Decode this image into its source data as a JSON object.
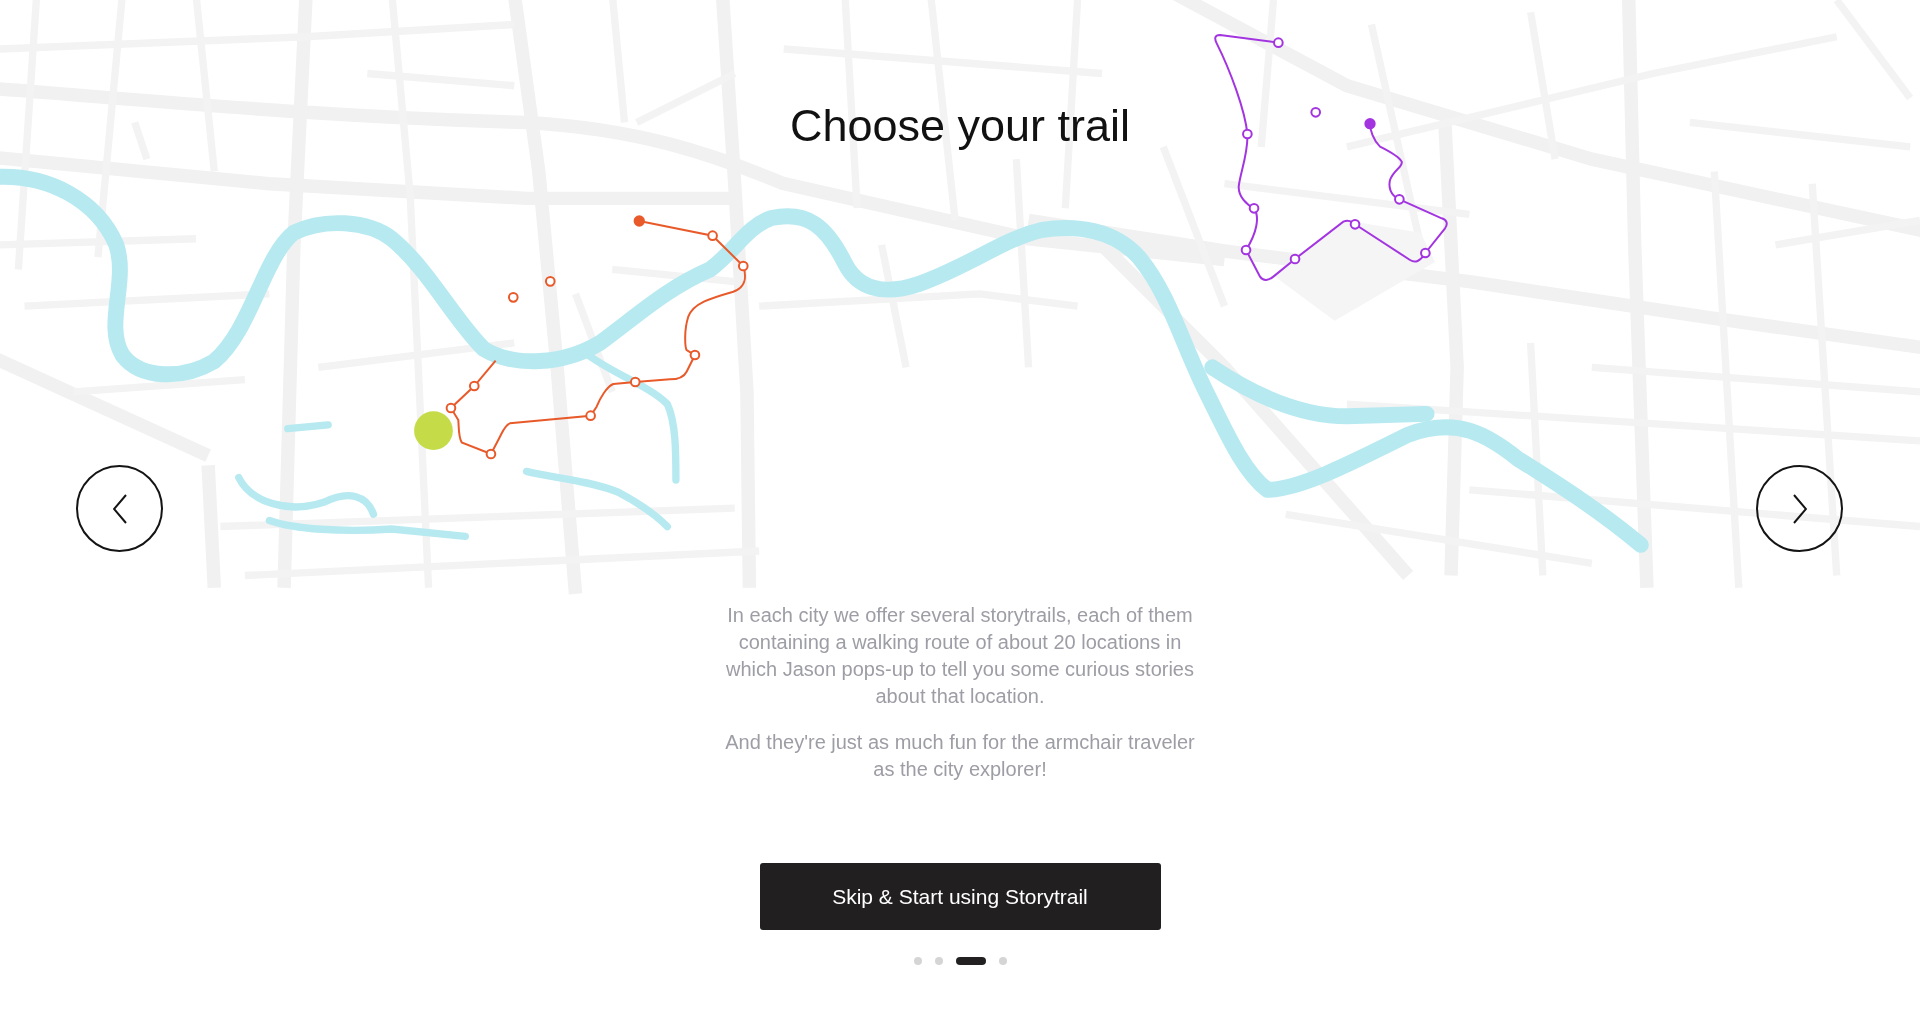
{
  "title": "Choose your trail",
  "description": [
    "In each city we offer several storytrails, each of them containing a walking route of about 20 locations in which Jason pops-up to tell you some curious stories about that location.",
    "And they're just as much fun for the armchair traveler as the city explorer!"
  ],
  "primary_button": {
    "label": "Skip & Start using Storytrail"
  },
  "pagination": [
    {
      "selected": false
    },
    {
      "selected": false
    },
    {
      "selected": true
    },
    {
      "selected": false
    }
  ]
}
